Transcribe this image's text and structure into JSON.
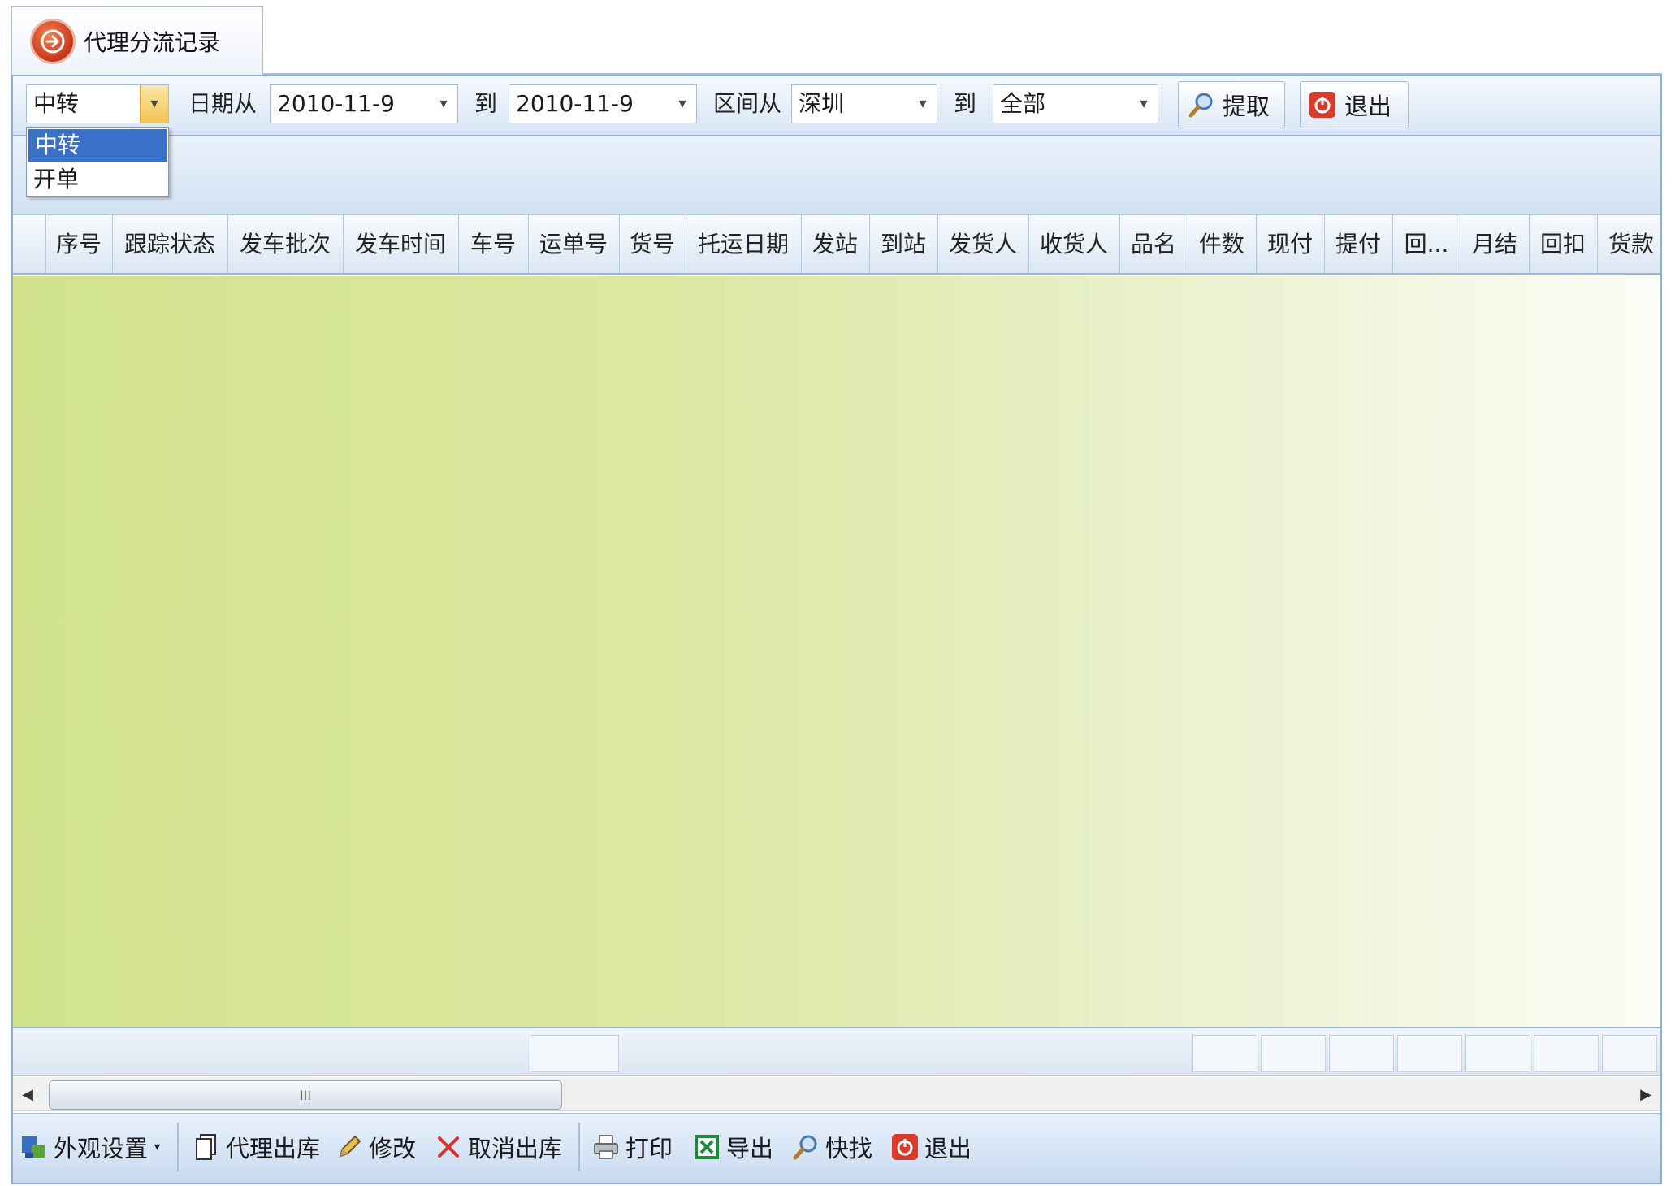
{
  "tab": {
    "title": "代理分流记录"
  },
  "toolbar": {
    "type_combo": "中转",
    "date_from_label": "日期从",
    "date_from": "2010-11-9",
    "to_label_1": "到",
    "date_to": "2010-11-9",
    "range_from_label": "区间从",
    "range_from": "深圳",
    "to_label_2": "到",
    "range_to": "全部",
    "fetch_label": "提取",
    "exit_label": "退出"
  },
  "dropdown": {
    "options": [
      "中转",
      "开单"
    ],
    "selected": "中转"
  },
  "grid": {
    "columns": [
      "序号",
      "跟踪状态",
      "发车批次",
      "发车时间",
      "车号",
      "运单号",
      "货号",
      "托运日期",
      "发站",
      "到站",
      "发货人",
      "收货人",
      "品名",
      "件数",
      "现付",
      "提付",
      "回...",
      "月结",
      "回扣",
      "货款"
    ],
    "rows": []
  },
  "scrollbar": {
    "thumb_grip": "III"
  },
  "bottom": {
    "appearance_label": "外观设置",
    "agent_out_label": "代理出库",
    "modify_label": "修改",
    "cancel_out_label": "取消出库",
    "print_label": "打印",
    "export_label": "导出",
    "quick_find_label": "快找",
    "exit_label": "退出"
  },
  "colors": {
    "accent": "#3a70c8",
    "frame": "#8fb0d2",
    "exit_red": "#d93a2a"
  }
}
